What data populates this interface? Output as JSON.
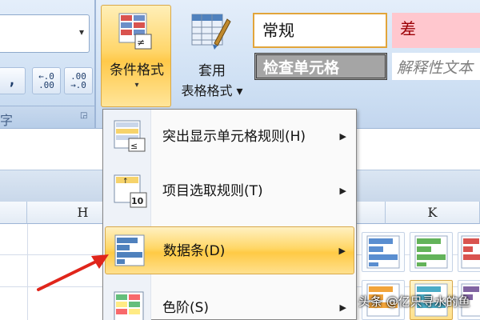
{
  "ribbon": {
    "number_group": {
      "format_dropdown_value": "",
      "comma_style_label": ",",
      "increase_decimal_label": "←.0\n.00",
      "decrease_decimal_label": ".00\n→.0",
      "group_label": "字"
    },
    "conditional_formatting": {
      "label": "条件格式",
      "caret": "▾"
    },
    "format_as_table": {
      "label_line1": "套用",
      "label_line2": "表格格式 ▾"
    },
    "cell_styles": {
      "normal": "常规",
      "bad": "差",
      "check_cell": "检查单元格",
      "explanatory": "解释性文本"
    }
  },
  "sheet": {
    "columns": [
      "H",
      "K"
    ]
  },
  "menu": {
    "items": [
      {
        "label": "突出显示单元格规则(H)",
        "icon": "highlight-cells-rules-icon",
        "highlighted": false
      },
      {
        "label": "项目选取规则(T)",
        "icon": "top-bottom-rules-icon",
        "highlighted": false
      },
      {
        "label": "数据条(D)",
        "icon": "data-bars-icon",
        "highlighted": true
      },
      {
        "label": "色阶(S)",
        "icon": "color-scales-icon",
        "highlighted": false
      }
    ],
    "submenu_arrow": "▶"
  },
  "colors": {
    "highlight": "#ffd767",
    "ribbon": "#cddff3",
    "arrow": "#e0251b",
    "bad_fill": "#ffc7ce"
  },
  "watermark": "头条 @亿只寻水的鱼"
}
